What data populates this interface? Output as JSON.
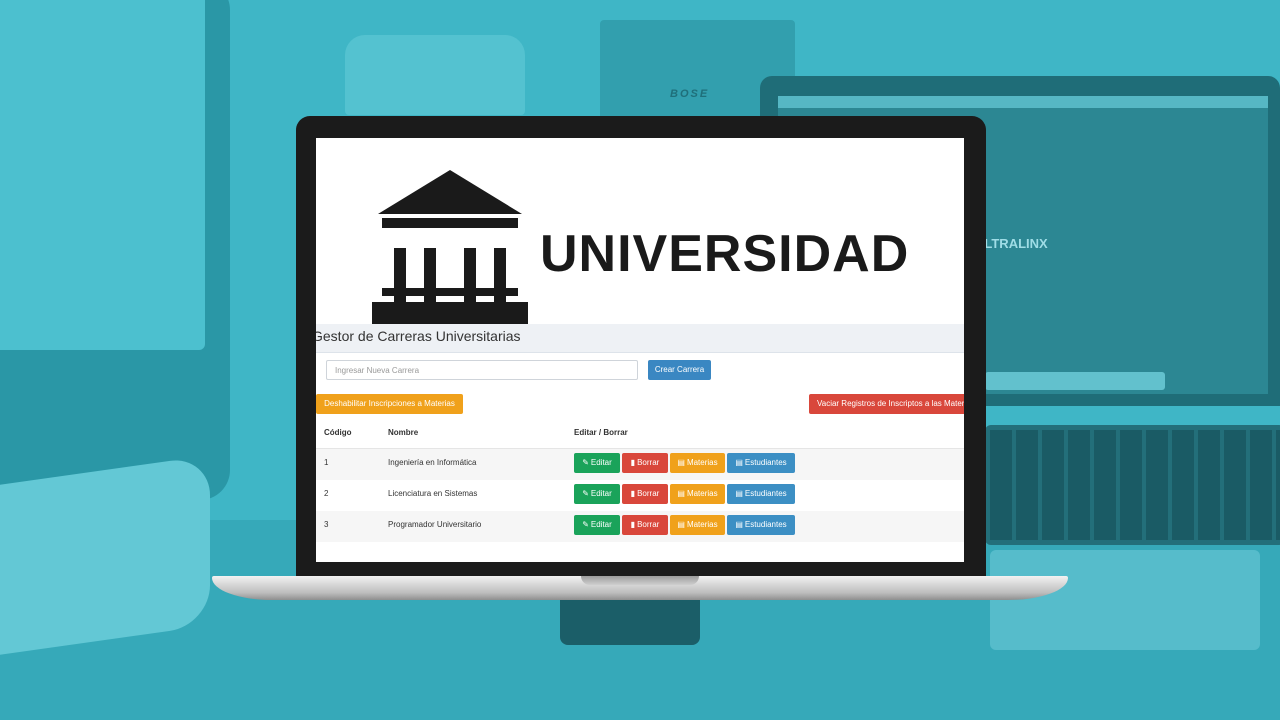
{
  "brand": {
    "name": "UNIVERSIDAD"
  },
  "page": {
    "title": "Gestor de Carreras Universitarias"
  },
  "form": {
    "placeholder": "Ingresar Nueva Carrera",
    "create_label": "Crear Carrera"
  },
  "actions": {
    "disable_label": "Deshabilitar Inscripciones a Materias",
    "empty_label": "Vaciar Registros de Inscriptos a las Materias"
  },
  "table": {
    "headers": {
      "code": "Código",
      "name": "Nombre",
      "edit": "Editar / Borrar"
    },
    "rows": [
      {
        "code": "1",
        "name": "Ingeniería en Informática"
      },
      {
        "code": "2",
        "name": "Licenciatura en Sistemas"
      },
      {
        "code": "3",
        "name": "Programador Universitario"
      }
    ],
    "buttons": {
      "edit": "Editar",
      "delete": "Borrar",
      "subjects": "Materias",
      "students": "Estudiantes"
    }
  },
  "background": {
    "speaker_brand": "BOSE",
    "screen_brand": "ULTRALINX"
  },
  "colors": {
    "backdrop": "#3fb6c6",
    "primary": "#3a87c2",
    "warning": "#f0a11b",
    "danger": "#d9473b",
    "success": "#1aa35a"
  }
}
